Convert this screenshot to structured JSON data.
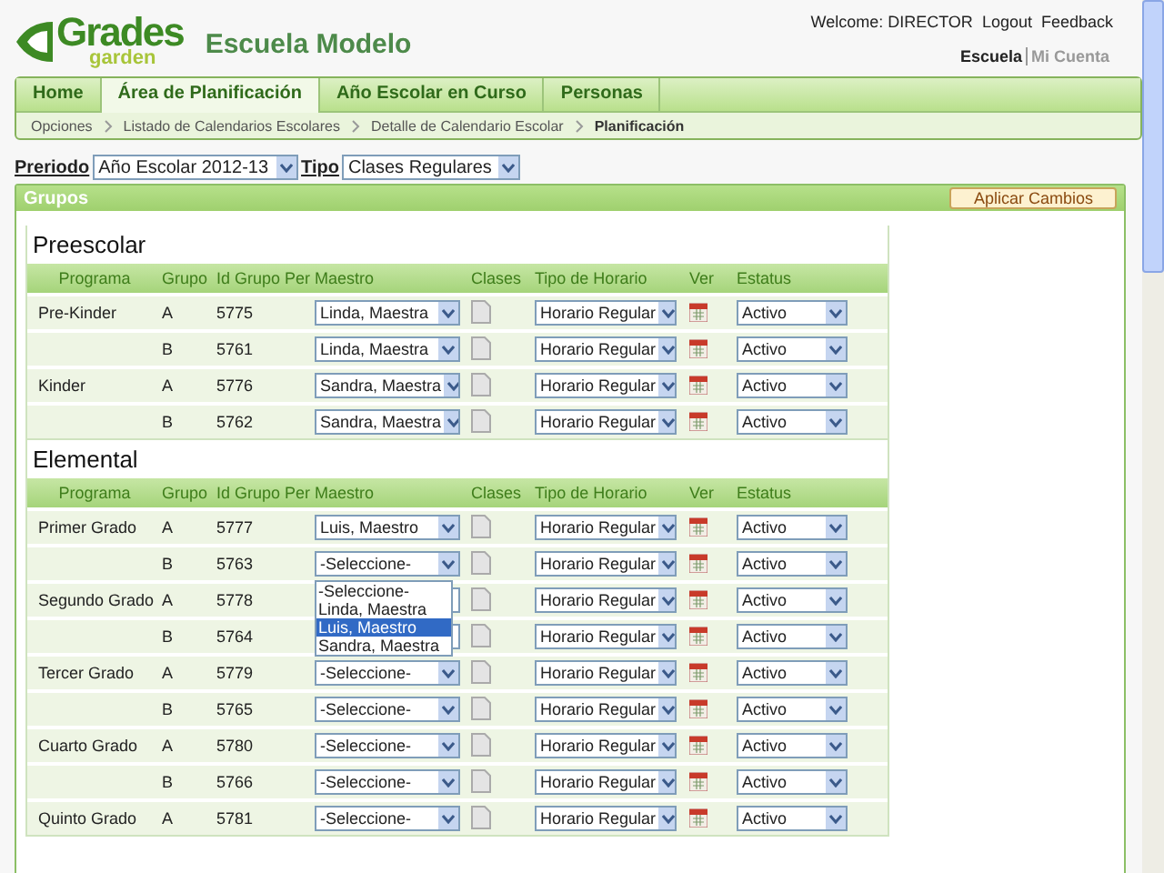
{
  "header": {
    "logo": {
      "top": "Grades",
      "bottom": "garden"
    },
    "school": "Escuela Modelo",
    "welcome": "Welcome: DIRECTOR",
    "links": [
      "Logout",
      "Feedback"
    ],
    "account_tabs": [
      {
        "label": "Escuela",
        "selected": true
      },
      {
        "label": "Mi Cuenta",
        "selected": false
      }
    ]
  },
  "nav": {
    "tabs": [
      {
        "label": "Home",
        "selected": false
      },
      {
        "label": "Área de Planificación",
        "selected": true
      },
      {
        "label": "Año Escolar en Curso",
        "selected": false
      },
      {
        "label": "Personas",
        "selected": false
      }
    ],
    "breadcrumb": [
      "Opciones",
      "Listado de Calendarios Escolares",
      "Detalle de Calendario Escolar",
      "Planificación"
    ]
  },
  "filters": [
    {
      "label": "Preriodo",
      "value": "Año Escolar 2012-13"
    },
    {
      "label": "Tipo",
      "value": "Clases Regulares"
    }
  ],
  "panel": {
    "title": "Grupos",
    "button": "Aplicar Cambios",
    "sections": [
      {
        "title": "Preescolar",
        "columns": [
          "Programa",
          "Grupo",
          "Id Grupo Per",
          "Maestro",
          "Clases",
          "Tipo de Horario",
          "Ver",
          "Estatus"
        ],
        "rows": [
          {
            "programa": "Pre-Kinder",
            "grupo": "A",
            "id": "5775",
            "maestro": "Linda, Maestra",
            "tipo": "Horario Regular",
            "estatus": "Activo"
          },
          {
            "grupo": "B",
            "id": "5761",
            "maestro": "Linda, Maestra",
            "tipo": "Horario Regular",
            "estatus": "Activo"
          },
          {
            "programa": "Kinder",
            "grupo": "A",
            "id": "5776",
            "maestro": "Sandra, Maestra",
            "tipo": "Horario Regular",
            "estatus": "Activo"
          },
          {
            "grupo": "B",
            "id": "5762",
            "maestro": "Sandra, Maestra",
            "tipo": "Horario Regular",
            "estatus": "Activo"
          }
        ]
      },
      {
        "title": "Elemental",
        "columns": [
          "Programa",
          "Grupo",
          "Id Grupo Per",
          "Maestro",
          "Clases",
          "Tipo de Horario",
          "Ver",
          "Estatus"
        ],
        "rows": [
          {
            "programa": "Primer Grado",
            "grupo": "A",
            "id": "5777",
            "maestro": "Luis, Maestro",
            "tipo": "Horario Regular",
            "estatus": "Activo"
          },
          {
            "grupo": "B",
            "id": "5763",
            "maestro": "-Seleccione-",
            "tipo": "Horario Regular",
            "estatus": "Activo",
            "maestro_options": [
              {
                "label": "-Seleccione-",
                "selected": false
              },
              {
                "label": "Linda, Maestra",
                "selected": false
              },
              {
                "label": "Luis, Maestro",
                "selected": true
              },
              {
                "label": "Sandra, Maestra",
                "selected": false
              }
            ]
          },
          {
            "programa": "Segundo Grado",
            "grupo": "A",
            "id": "5778",
            "tipo": "Horario Regular",
            "estatus": "Activo"
          },
          {
            "grupo": "B",
            "id": "5764",
            "tipo": "Horario Regular",
            "estatus": "Activo"
          },
          {
            "programa": "Tercer Grado",
            "grupo": "A",
            "id": "5779",
            "maestro": "-Seleccione-",
            "tipo": "Horario Regular",
            "estatus": "Activo"
          },
          {
            "grupo": "B",
            "id": "5765",
            "maestro": "-Seleccione-",
            "tipo": "Horario Regular",
            "estatus": "Activo"
          },
          {
            "programa": "Cuarto Grado",
            "grupo": "A",
            "id": "5780",
            "maestro": "-Seleccione-",
            "tipo": "Horario Regular",
            "estatus": "Activo"
          },
          {
            "grupo": "B",
            "id": "5766",
            "maestro": "-Seleccione-",
            "tipo": "Horario Regular",
            "estatus": "Activo"
          },
          {
            "programa": "Quinto Grado",
            "grupo": "A",
            "id": "5781",
            "maestro": "-Seleccione-",
            "tipo": "Horario Regular",
            "estatus": "Activo"
          }
        ]
      }
    ]
  }
}
